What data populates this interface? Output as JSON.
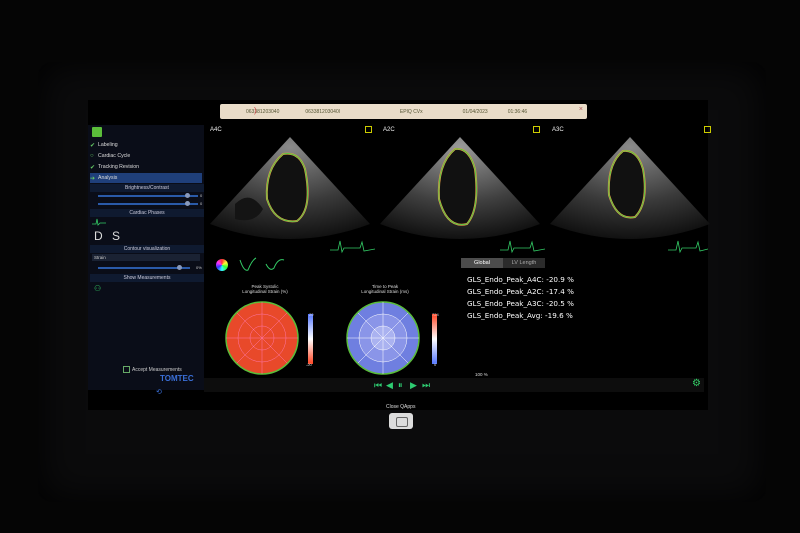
{
  "header": {
    "id1": "063381203040",
    "id2": "063381203040l",
    "app": "EPIQ CVx",
    "date": "01/04/2023",
    "time": "01:36:46"
  },
  "sidebar": {
    "items": [
      {
        "label": "Labeling",
        "checked": true
      },
      {
        "label": "Cardiac Cycle",
        "checked": false
      },
      {
        "label": "Tracking Revision",
        "checked": true
      },
      {
        "label": "Analysis",
        "checked": false
      }
    ],
    "section_brightness": "Brightness/Contrast",
    "slider_values": [
      "0",
      "0"
    ],
    "section_phases": "Cardiac Phases",
    "phases": "D S",
    "section_contour": "Contour visualization",
    "contour_mode": "Strain",
    "contour_value": "0%",
    "section_measure": "Show Measurements",
    "accept_label": "Accept Measurements",
    "logo": "TOMTEC"
  },
  "views": [
    {
      "label": "A4C"
    },
    {
      "label": "A2C"
    },
    {
      "label": "A3C"
    }
  ],
  "tabs": {
    "global": "Global",
    "lv": "LV Length"
  },
  "results": [
    "GLS_Endo_Peak_A4C: -20.9 %",
    "GLS_Endo_Peak_A2C: -17.4 %",
    "GLS_Endo_Peak_A3C: -20.5 %",
    "GLS_Endo_Peak_Avg: -19.6 %"
  ],
  "maps": [
    {
      "title1": "Peak Systolic",
      "title2": "Longitudinal Strain (%)",
      "scale_top": "20",
      "scale_bottom": "-20"
    },
    {
      "title1": "Time to Peak",
      "title2": "Longitudinal Strain (ms)",
      "scale_top": "724",
      "scale_bottom": "0"
    }
  ],
  "zoom": "100 %",
  "close_label": "Close QApps",
  "colors": {
    "accent": "#5bbd3a",
    "myocardium_red": "#e8492a",
    "blue_map": "#6f7fe0",
    "header": "#e9dcc8"
  }
}
